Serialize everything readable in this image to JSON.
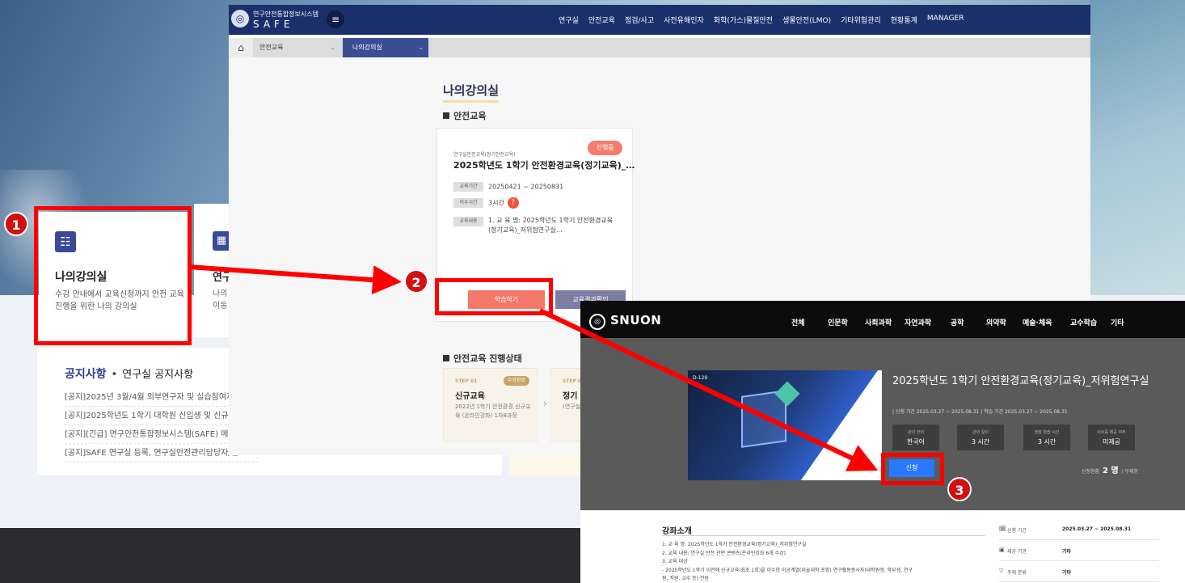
{
  "background": {
    "card1": {
      "title": "나의강의실",
      "desc": "수강 안내에서 교육신청까지 안전 교육 진행을 위한 나의 강의실"
    },
    "card2": {
      "title": "연구",
      "desc": "나의 이동"
    },
    "notice": {
      "title": "공지사항",
      "subtitle": "연구실 공지사항",
      "items": [
        "[공지]2025년 3월/4월 외부연구자 및 실습참여자 안",
        "[공지]2025학년도 1학기 대학원 신입생 및 신규 임",
        "[공지][긴급] 연구안전통합정보시스템(SAFE) 메인",
        "[공지]SAFE 연구실 등록, 연구실안전관리담당자/연"
      ]
    }
  },
  "safe": {
    "logo_kr": "연구안전통합정보시스템",
    "logo_en": "SAFE",
    "nav": [
      "연구실",
      "안전교육",
      "점검/사고",
      "사전유해인자",
      "화학(가스)물질안전",
      "생물안전(LMO)",
      "기타위험관리",
      "현황통계",
      "MANAGER"
    ],
    "breadcrumb": {
      "level1": "안전교육",
      "level2": "나의강의실"
    },
    "page_title": "나의강의실",
    "section1": "안전교육",
    "course": {
      "badge": "진행중",
      "category": "연구실안전교육(정기안전교육)",
      "title": "2025학년도 1학기 안전환경교육(정기교육)_…",
      "period_label": "교육기간",
      "period": "20250421 ~ 20250831",
      "hours_label": "이수시간",
      "hours": "3시간",
      "help": "?",
      "content_label": "교육내용",
      "content": "1. 교 육 명: 2025학년도 1학기 안전환경교육(정기교육)_저위험연구실…",
      "study_button": "학습하기",
      "result_button": "교육결과확인"
    },
    "section2": "안전교육 진행상태",
    "steps": [
      {
        "no": "STEP 01",
        "badge": "수강완료",
        "title": "신규교육",
        "desc": "2022년 1학기 안전환경 신규교육 (온라인강좌) 1차8과정"
      },
      {
        "no": "STEP 0",
        "title": "정기",
        "desc": "(연구실 연구실 보수)"
      }
    ]
  },
  "snuon": {
    "logo": "SNUON",
    "nav": [
      "전체",
      "인문학",
      "사회과학",
      "자연과학",
      "공학",
      "의약학",
      "예술·체육",
      "교수학습",
      "기타"
    ],
    "thumb_tag": "D-129",
    "title": "2025학년도 1학기 안전환경교육(정기교육)_저위험연구실",
    "dates": "| 신청 기간 2025.03.27 ~ 2025.08.31 | 학습 기간 2025.03.27 ~ 2025.08.31",
    "stats": [
      {
        "k": "강의 언어",
        "v": "한국어"
      },
      {
        "k": "강의 길이",
        "v": "3 시간"
      },
      {
        "k": "권장 학습 시간",
        "v": "3 시간"
      },
      {
        "k": "이수증 제공 여부",
        "v": "미제공"
      }
    ],
    "apply_button": "신청",
    "count_label": "신청현황",
    "count_value": "2 명",
    "count_limit": "/ 무제한",
    "intro_title": "강좌소개",
    "intro_lines": [
      "1. 교 육 명: 2025학년도 1학기 안전환경교육(정기교육)_저위험연구실",
      "2. 교육 내용: 연구실 안전 관련 콘텐츠(온라인강좌 6개 수강)",
      "3. 교육 대상",
      "- 2025학년도 1학기 이전에 신규교육(최초 1회)을 이수한 이공계열(미술대학 포함) 연구활동종사자(대학원생, 학부생, 연구",
      "원, 직원, 교수 등) 전원"
    ],
    "info": [
      {
        "icon": "🗓",
        "k": "신청 기간",
        "v": "2025.03.27 ~ 2025.08.31"
      },
      {
        "icon": "▣",
        "k": "제공 기관",
        "v": "기타"
      },
      {
        "icon": "▽",
        "k": "주제 분류",
        "v": "기타"
      }
    ]
  },
  "markers": [
    "1",
    "2",
    "3"
  ],
  "colors": {
    "highlight": "#ff0000",
    "marker": "#d11111",
    "safe_header": "#1b2f6b",
    "study_button": "#f3786a",
    "apply_button": "#2979ff"
  }
}
